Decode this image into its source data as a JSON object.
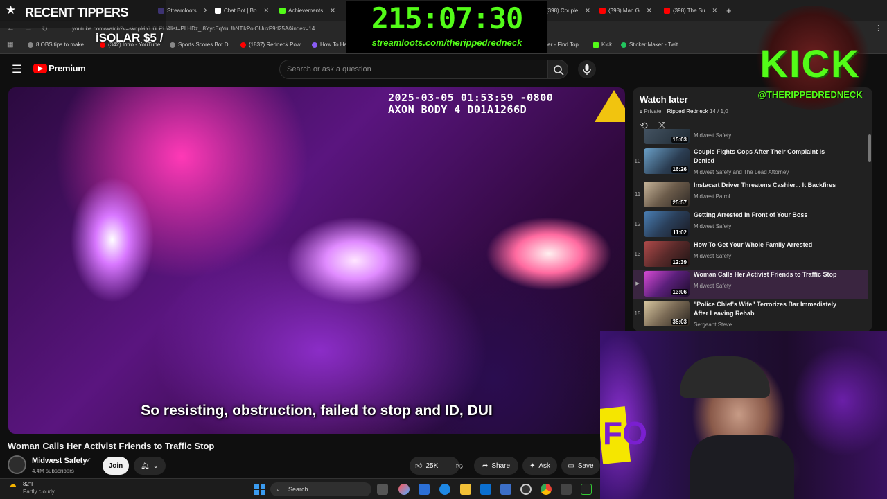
{
  "browser": {
    "tabs": [
      {
        "label": "Streamloots",
        "color": "#7b61ff"
      },
      {
        "label": "Chat Bot | Bo",
        "color": "#ffffff"
      },
      {
        "label": "Achievements",
        "color": "#53fc18"
      },
      {
        "label": "(398) Couple",
        "color": "#ff0000"
      },
      {
        "label": "(398) Man G",
        "color": "#ff0000"
      },
      {
        "label": "(398) The Su",
        "color": "#ff0000"
      }
    ],
    "url": "youtube.com/watch?v=sknpMYU0LPU&list=PLHDz_I8YycEqYuUhNTikPolOUuxP9d25A&index=14",
    "bookmarks": [
      {
        "label": "8 OBS tips to make...",
        "color": "#888888"
      },
      {
        "label": "(342) Intro - YouTube",
        "color": "#ff0000"
      },
      {
        "label": "Sports Scores Bot D...",
        "color": "#888888"
      },
      {
        "label": "(1837) Redneck Pow...",
        "color": "#ff0000"
      },
      {
        "label": "How To Ha",
        "color": "#8a5cf6"
      },
      {
        "label": "...over - Find Top...",
        "color": "#888888"
      },
      {
        "label": "Kick",
        "color": "#53fc18"
      },
      {
        "label": "Sticker Maker - Twit...",
        "color": "#22c55e"
      }
    ]
  },
  "youtube": {
    "brand": "Premium",
    "search_placeholder": "Search or ask a question"
  },
  "video": {
    "timestamp_line1": "2025-03-05 01:53:59 -0800",
    "timestamp_line2": "AXON BODY 4 D01A1266D",
    "subtitle": "So resisting, obstruction, failed to stop and ID, DUI",
    "title": "Woman Calls Her Activist Friends to Traffic Stop",
    "channel": "Midwest Safety",
    "subscribers": "4.4M subscribers",
    "join_label": "Join",
    "likes": "25K",
    "share_label": "Share",
    "ask_label": "Ask",
    "save_label": "Save"
  },
  "playlist": {
    "title": "Watch later",
    "privacy": "Private",
    "owner": "Ripped Redneck",
    "position": "14 / 1,0",
    "partial_item": {
      "duration": "15:03",
      "channel": "Midwest Safety"
    },
    "items": [
      {
        "index": "10",
        "title": "Couple Fights Cops After Their Complaint is Denied",
        "channel": "Midwest Safety and The Lead Attorney",
        "duration": "16:26"
      },
      {
        "index": "11",
        "title": "Instacart Driver Threatens Cashier... It Backfires",
        "channel": "Midwest Patrol",
        "duration": "25:57"
      },
      {
        "index": "12",
        "title": "Getting Arrested in Front of Your Boss",
        "channel": "Midwest Safety",
        "duration": "11:02"
      },
      {
        "index": "13",
        "title": "How To Get Your Whole Family Arrested",
        "channel": "Midwest Safety",
        "duration": "12:39"
      },
      {
        "index": "▶",
        "title": "Woman Calls Her Activist Friends to Traffic Stop",
        "channel": "Midwest Safety",
        "duration": "13:06"
      },
      {
        "index": "15",
        "title": "\"Police Chief's Wife\" Terrorizes Bar Immediately After Leaving Rehab",
        "channel": "Sergeant Steve",
        "duration": "35:03"
      }
    ]
  },
  "overlays": {
    "recent_tippers": "RECENT TIPPERS",
    "tipper_entry": "iSOLAR $5 /",
    "countdown": "215:07:30",
    "streamloots_url": "streamloots.com/therippedredneck",
    "kick_word": "KICK",
    "kick_handle": "@THERIPPEDREDNECK",
    "webcam_sign": "FO"
  },
  "taskbar": {
    "weather_temp": "82°F",
    "weather_desc": "Partly cloudy",
    "search_label": "Search"
  }
}
